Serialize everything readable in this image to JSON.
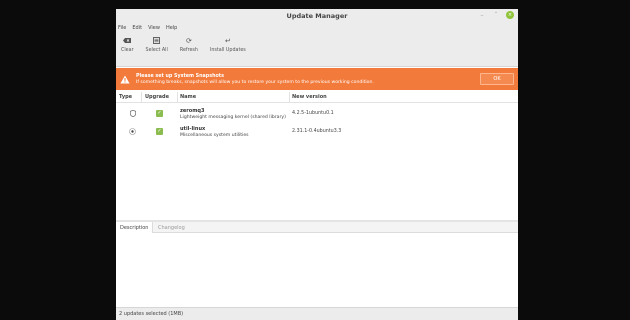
{
  "window": {
    "title": "Update Manager"
  },
  "menu": [
    "File",
    "Edit",
    "View",
    "Help"
  ],
  "toolbar": {
    "clear": "Clear",
    "select_all": "Select All",
    "refresh": "Refresh",
    "install": "Install Updates"
  },
  "banner": {
    "title": "Please set up System Snapshots",
    "message": "If something breaks, snapshots will allow you to restore your system to the previous working condition.",
    "ok": "OK",
    "color": "#f27a3b"
  },
  "table": {
    "headers": {
      "type": "Type",
      "upgrade": "Upgrade",
      "name": "Name",
      "version": "New version"
    },
    "rows": [
      {
        "type_icon": "shield-icon",
        "checked": true,
        "name": "zeromq3",
        "description": "Lightweight messaging kernel (shared library)",
        "version": "4.2.5-1ubuntu0.1"
      },
      {
        "type_icon": "package-icon",
        "checked": true,
        "name": "util-linux",
        "description": "Miscellaneous system utilities",
        "version": "2.31.1-0.4ubuntu3.3"
      }
    ]
  },
  "tabs": {
    "description": "Description",
    "changelog": "Changelog"
  },
  "status": {
    "text": "2 updates selected (1MB)"
  },
  "colors": {
    "checkbox": "#8bbc4f",
    "close_button": "#8fc33a"
  }
}
